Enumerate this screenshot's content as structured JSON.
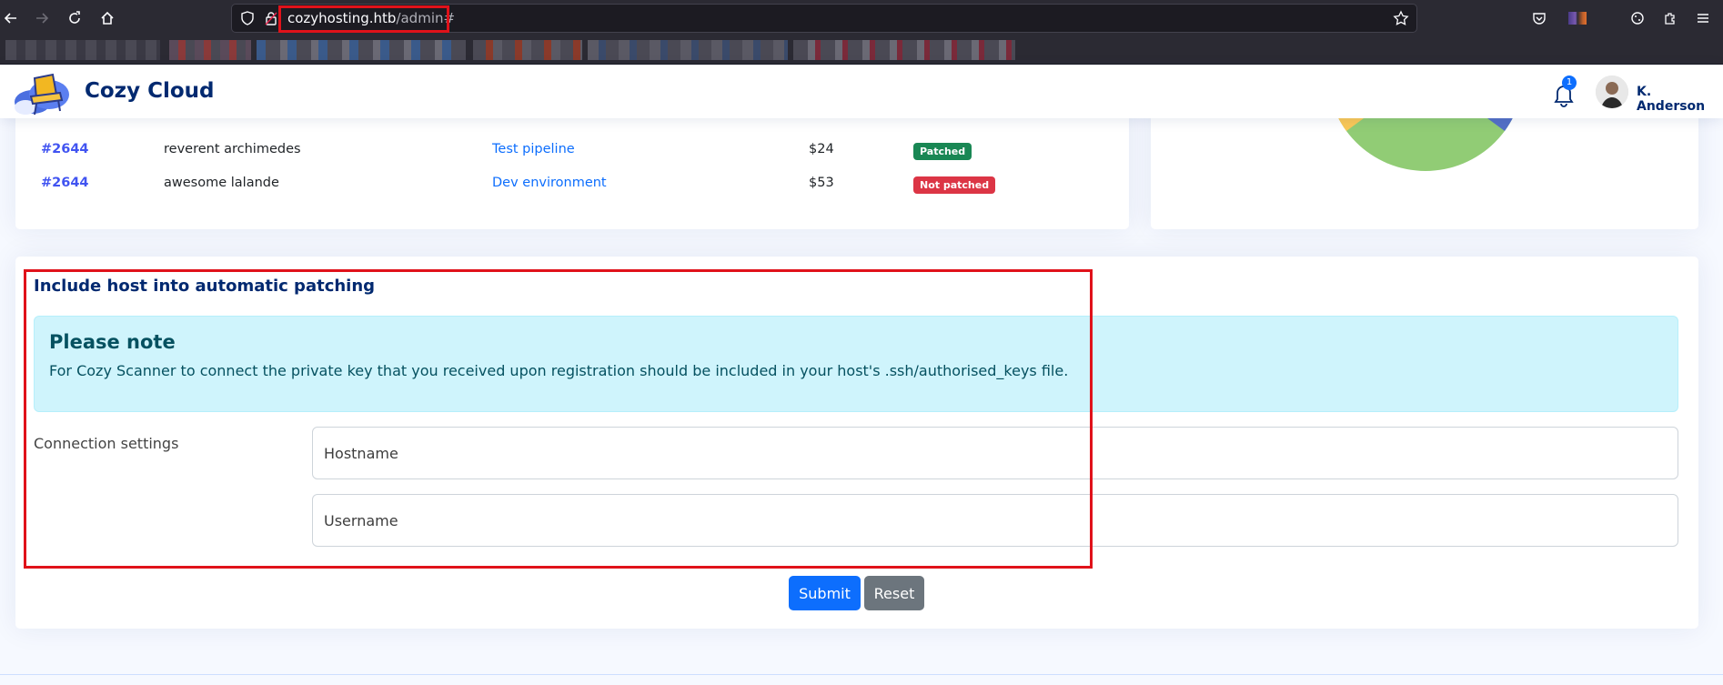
{
  "browser": {
    "url_host": "cozyhosting.htb",
    "url_path": "/admin#"
  },
  "header": {
    "brand": "Cozy Cloud",
    "notification_count": "1",
    "user_name": "K. Anderson"
  },
  "table": {
    "rows": [
      {
        "id": "#2644",
        "name": "reverent archimedes",
        "project": "Test pipeline",
        "price": "$24",
        "status": "Patched",
        "status_color": "#198754"
      },
      {
        "id": "#2644",
        "name": "awesome lalande",
        "project": "Dev environment",
        "price": "$53",
        "status": "Not patched",
        "status_color": "#dc3545"
      }
    ]
  },
  "form": {
    "title": "Include host into automatic patching",
    "alert_heading": "Please note",
    "alert_text": "For Cozy Scanner to connect the private key that you received upon registration should be included in your host's .ssh/authorised_keys file.",
    "connection_label": "Connection settings",
    "hostname_placeholder": "Hostname",
    "username_placeholder": "Username",
    "submit_label": "Submit",
    "reset_label": "Reset"
  },
  "colors": {
    "brand": "#012970",
    "link": "#0d6efd",
    "id_link": "#4154f1",
    "alert_bg": "#cff4fc",
    "highlight": "#e0121a"
  }
}
